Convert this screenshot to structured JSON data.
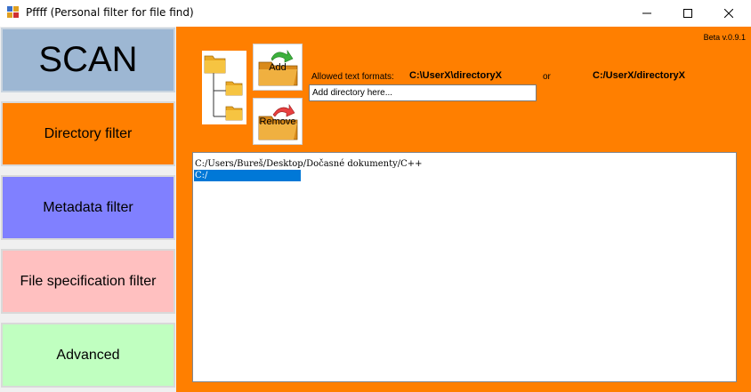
{
  "window": {
    "title": "Pffff (Personal filter for file find)",
    "minimize_icon": "minimize-icon",
    "maximize_icon": "maximize-icon",
    "close_icon": "close-icon"
  },
  "sidebar": {
    "scan_label": "SCAN",
    "directory_filter_label": "Directory filter",
    "metadata_filter_label": "Metadata filter",
    "file_spec_filter_label": "File specification filter",
    "advanced_label": "Advanced"
  },
  "panel": {
    "version": "Beta v.0.9.1",
    "add_label": "Add",
    "remove_label": "Remove",
    "allowed_formats_label": "Allowed text formats:",
    "format_backslash": "C:\\UserX\\directoryX",
    "or_label": "or",
    "format_slash": "C:/UserX/directoryX",
    "directory_input_value": "Add directory here..."
  },
  "directories": [
    {
      "path": "C:/Users/Bureš/Desktop/Dočasné dokumenty/C++",
      "selected": false
    },
    {
      "path": "C:/",
      "selected": true
    }
  ],
  "colors": {
    "panel_bg": "#ff7f00",
    "scan_bg": "#9db7d3",
    "directory_filter_bg": "#ff7f00",
    "metadata_filter_bg": "#8080ff",
    "file_spec_filter_bg": "#ffc0c0",
    "advanced_bg": "#c0ffc0",
    "selection": "#0078d7"
  }
}
